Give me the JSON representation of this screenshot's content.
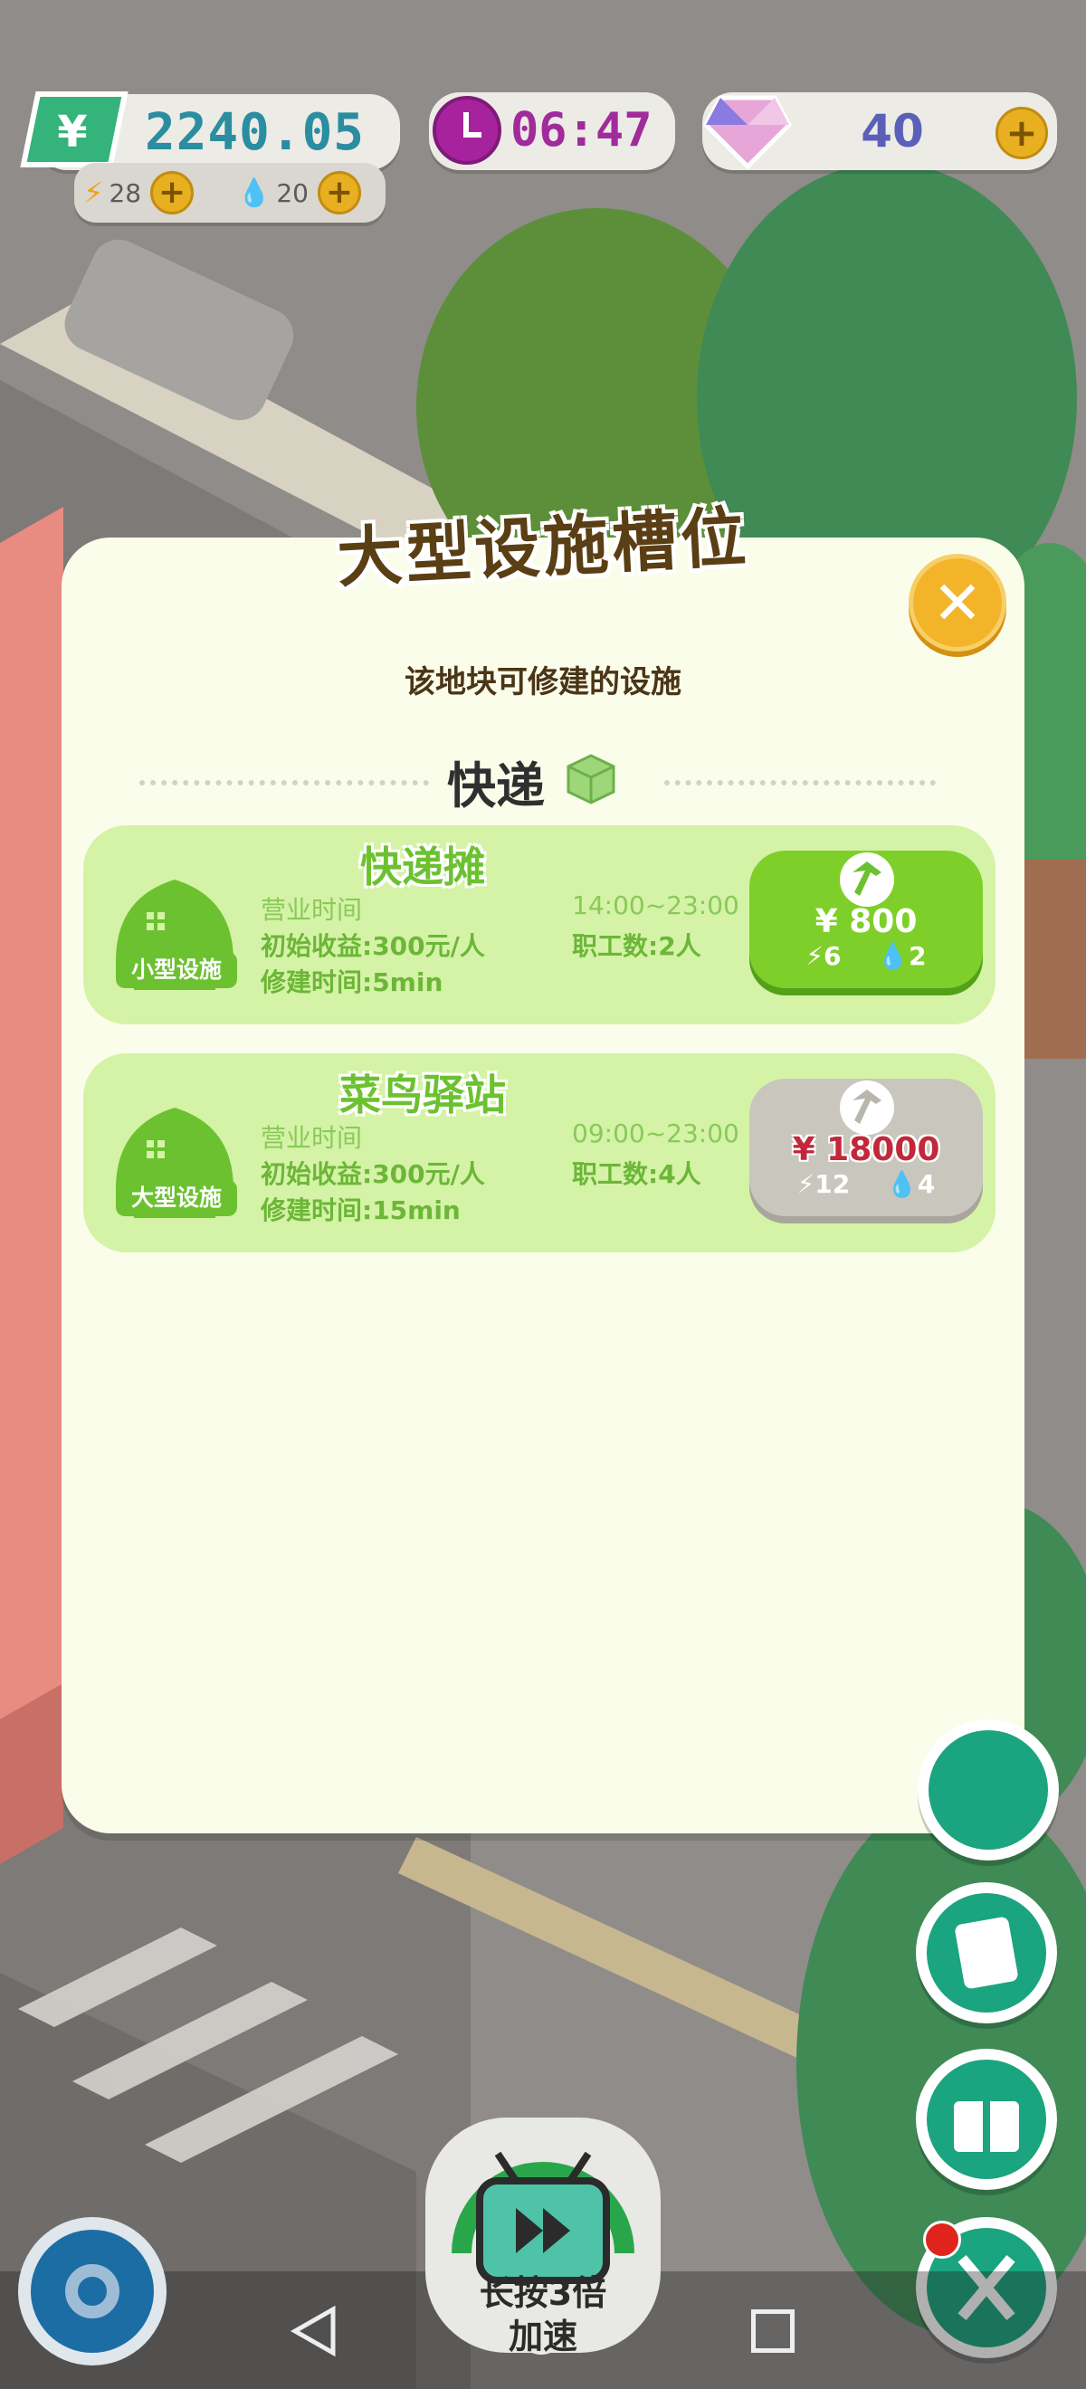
{
  "hud": {
    "money": "2240.05",
    "energy": "28",
    "water": "20",
    "timer": "06:47",
    "gems": "40"
  },
  "dialog": {
    "title": "大型设施槽位",
    "subtitle": "该地块可修建的设施",
    "section_label": "快递",
    "facilities": [
      {
        "name": "快递摊",
        "tag": "小型设施",
        "hours_label": "营业时间",
        "hours": "14:00~23:00",
        "income": "初始收益:300元/人",
        "staff": "职工数:2人",
        "build_time": "修建时间:5min",
        "price": "800",
        "energy_cost": "6",
        "water_cost": "2",
        "affordable": true
      },
      {
        "name": "菜鸟驿站",
        "tag": "大型设施",
        "hours_label": "营业时间",
        "hours": "09:00~23:00",
        "income": "初始收益:300元/人",
        "staff": "职工数:4人",
        "build_time": "修建时间:15min",
        "price": "18000",
        "energy_cost": "12",
        "water_cost": "4",
        "affordable": false
      }
    ]
  },
  "controls": {
    "speed_label_1": "长按3倍",
    "speed_label_2": "加速"
  },
  "colors": {
    "dialog_bg": "#fbfdeb",
    "card_bg": "#d4f3a6",
    "accent_green": "#6cc130",
    "close_yellow": "#f4b42a"
  }
}
